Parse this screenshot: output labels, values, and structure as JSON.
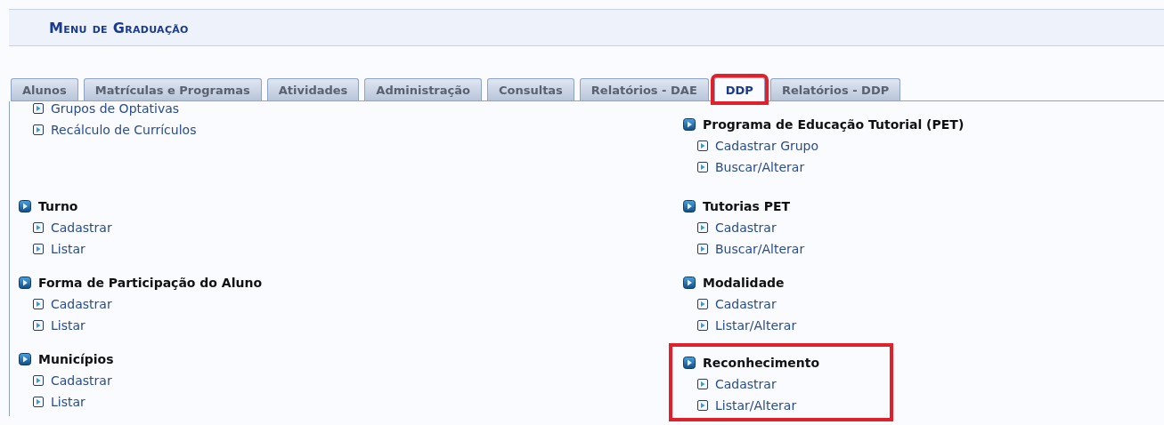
{
  "title": "Menu de Graduação",
  "tabs": [
    {
      "label": "Alunos",
      "selected": false,
      "highlighted": false
    },
    {
      "label": "Matrículas e Programas",
      "selected": false,
      "highlighted": false
    },
    {
      "label": "Atividades",
      "selected": false,
      "highlighted": false
    },
    {
      "label": "Administração",
      "selected": false,
      "highlighted": false
    },
    {
      "label": "Consultas",
      "selected": false,
      "highlighted": false
    },
    {
      "label": "Relatórios - DAE",
      "selected": false,
      "highlighted": false
    },
    {
      "label": "DDP",
      "selected": true,
      "highlighted": true
    },
    {
      "label": "Relatórios - DDP",
      "selected": false,
      "highlighted": false
    }
  ],
  "left_column": [
    {
      "highlighted": false,
      "items": [
        "Grupos de Optativas",
        "Recálculo de Currículos"
      ]
    },
    {
      "title": "Turno",
      "highlighted": false,
      "items": [
        "Cadastrar",
        "Listar"
      ]
    },
    {
      "title": "Forma de Participação do Aluno",
      "highlighted": false,
      "items": [
        "Cadastrar",
        "Listar"
      ]
    },
    {
      "title": "Municípios",
      "highlighted": false,
      "items": [
        "Cadastrar",
        "Listar"
      ]
    }
  ],
  "right_column": [
    {
      "title": "Programa de Educação Tutorial (PET)",
      "highlighted": false,
      "items": [
        "Cadastrar Grupo",
        "Buscar/Alterar"
      ]
    },
    {
      "title": "Tutorias PET",
      "highlighted": false,
      "items": [
        "Cadastrar",
        "Buscar/Alterar"
      ]
    },
    {
      "title": "Modalidade",
      "highlighted": false,
      "items": [
        "Cadastrar",
        "Listar/Alterar"
      ]
    },
    {
      "title": "Reconhecimento",
      "highlighted": true,
      "items": [
        "Cadastrar",
        "Listar/Alterar"
      ]
    }
  ]
}
